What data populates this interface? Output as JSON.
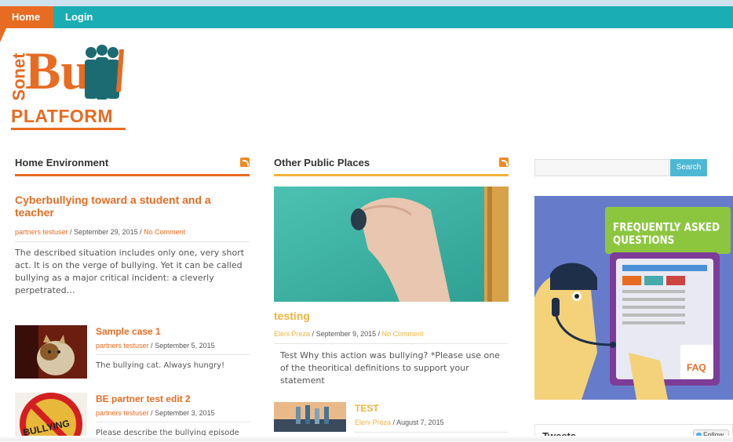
{
  "nav": {
    "home": "Home",
    "login": "Login"
  },
  "logo": {
    "sonet": "Sonet",
    "bu": "Bu",
    "platform": "PLATFORM"
  },
  "columns": {
    "home_env": "Home Environment",
    "other_public": "Other Public Places"
  },
  "home_env": {
    "featured": {
      "title": "Cyberbullying toward a student and a teacher",
      "author": "partners testuser",
      "date": "September 29, 2015",
      "comments": "No Comment",
      "excerpt": "The described situation includes only one, very short act. It is on the verge of bullying. Yet it can be called bullying as a major critical incident: a cleverly perpetrated…"
    },
    "items": [
      {
        "title": "Sample case 1",
        "author": "partners testuser",
        "date": "September 5, 2015",
        "excerpt": "The bullying cat. Always hungry!"
      },
      {
        "title": "BE partner test edit 2",
        "author": "partners testuser",
        "date": "September 3, 2015",
        "excerpt": "Please describe the bullying episode"
      }
    ],
    "thumb2_text": "BULLYING"
  },
  "other_public": {
    "featured": {
      "title": "testing",
      "author": "Eleni Preza",
      "date": "September 9, 2015",
      "comments": "No Comment",
      "excerpt": "Test Why this action was bullying? *Please use one of the theoritical definitions to support your statement"
    },
    "items": [
      {
        "title": "TEST",
        "author": "Eleni Preza",
        "date": "August 7, 2015"
      }
    ]
  },
  "sidebar": {
    "search_placeholder": "",
    "search_button": "Search",
    "faq_title": "FREQUENTLY ASKED QUESTIONS",
    "faq_badge": "FAQ",
    "tweets_title": "Tweets",
    "follow_label": "Follow"
  },
  "separator": "/",
  "colors": {
    "orange": "#e86b22",
    "teal": "#1aadb4",
    "yellow": "#f3b33d",
    "search_blue": "#4cb8d4"
  }
}
